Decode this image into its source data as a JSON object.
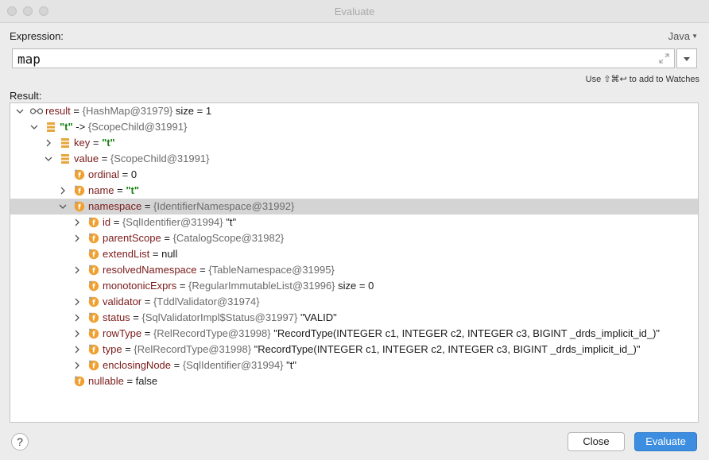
{
  "window": {
    "title": "Evaluate"
  },
  "expression": {
    "label": "Expression:",
    "language": "Java",
    "value": "map",
    "hint": "Use ⇧⌘↩ to add to Watches"
  },
  "result": {
    "label": "Result:",
    "rows": [
      {
        "name": "result",
        "eq": " = ",
        "ref": "{HashMap@31979}",
        "extra": "  size = 1"
      },
      {
        "name": "\"t\"",
        "eq": " -> ",
        "ref": "{ScopeChild@31991}",
        "extra": ""
      },
      {
        "name": "key",
        "eq": " = ",
        "ref": "",
        "str": "\"t\""
      },
      {
        "name": "value",
        "eq": " = ",
        "ref": "{ScopeChild@31991}",
        "extra": ""
      },
      {
        "name": "ordinal",
        "eq": " = ",
        "plain": "0"
      },
      {
        "name": "name",
        "eq": " = ",
        "str": "\"t\""
      },
      {
        "name": "namespace",
        "eq": " = ",
        "ref": "{IdentifierNamespace@31992}",
        "extra": ""
      },
      {
        "name": "id",
        "eq": " = ",
        "ref": "{SqlIdentifier@31994}",
        "extra": " \"t\""
      },
      {
        "name": "parentScope",
        "eq": " = ",
        "ref": "{CatalogScope@31982}",
        "extra": ""
      },
      {
        "name": "extendList",
        "eq": " = ",
        "plain": "null"
      },
      {
        "name": "resolvedNamespace",
        "eq": " = ",
        "ref": "{TableNamespace@31995}",
        "extra": ""
      },
      {
        "name": "monotonicExprs",
        "eq": " = ",
        "ref": "{RegularImmutableList@31996}",
        "extra": "  size = 0"
      },
      {
        "name": "validator",
        "eq": " = ",
        "ref": "{TddlValidator@31974}",
        "extra": ""
      },
      {
        "name": "status",
        "eq": " = ",
        "ref": "{SqlValidatorImpl$Status@31997}",
        "extra": " \"VALID\""
      },
      {
        "name": "rowType",
        "eq": " = ",
        "ref": "{RelRecordType@31998}",
        "extra": " \"RecordType(INTEGER c1, INTEGER c2, INTEGER c3, BIGINT _drds_implicit_id_)\""
      },
      {
        "name": "type",
        "eq": " = ",
        "ref": "{RelRecordType@31998}",
        "extra": " \"RecordType(INTEGER c1, INTEGER c2, INTEGER c3, BIGINT _drds_implicit_id_)\""
      },
      {
        "name": "enclosingNode",
        "eq": " = ",
        "ref": "{SqlIdentifier@31994}",
        "extra": " \"t\""
      },
      {
        "name": "nullable",
        "eq": " = ",
        "plain": "false"
      }
    ]
  },
  "footer": {
    "help": "?",
    "close": "Close",
    "evaluate": "Evaluate"
  },
  "colors": {
    "accent": "#3d8ee0",
    "field_icon": "#f0a030",
    "selection": "#d4d4d4"
  }
}
